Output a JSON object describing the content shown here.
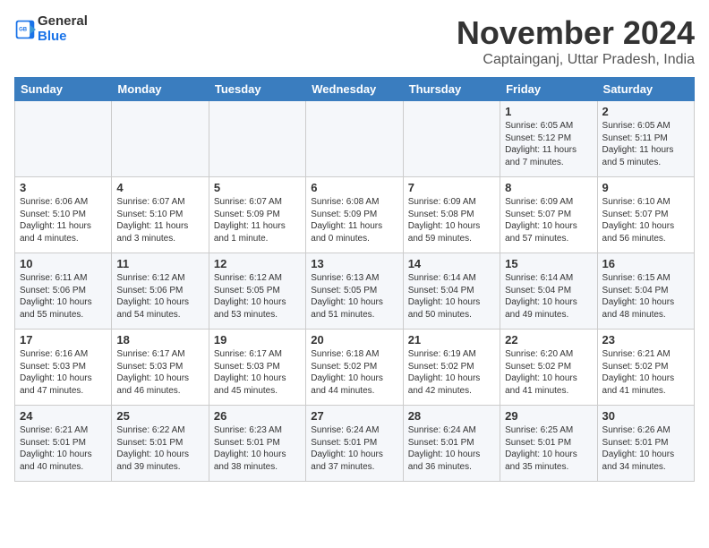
{
  "header": {
    "logo_general": "General",
    "logo_blue": "Blue",
    "month_title": "November 2024",
    "location": "Captainganj, Uttar Pradesh, India"
  },
  "weekdays": [
    "Sunday",
    "Monday",
    "Tuesday",
    "Wednesday",
    "Thursday",
    "Friday",
    "Saturday"
  ],
  "weeks": [
    [
      {
        "day": "",
        "info": ""
      },
      {
        "day": "",
        "info": ""
      },
      {
        "day": "",
        "info": ""
      },
      {
        "day": "",
        "info": ""
      },
      {
        "day": "",
        "info": ""
      },
      {
        "day": "1",
        "info": "Sunrise: 6:05 AM\nSunset: 5:12 PM\nDaylight: 11 hours and 7 minutes."
      },
      {
        "day": "2",
        "info": "Sunrise: 6:05 AM\nSunset: 5:11 PM\nDaylight: 11 hours and 5 minutes."
      }
    ],
    [
      {
        "day": "3",
        "info": "Sunrise: 6:06 AM\nSunset: 5:10 PM\nDaylight: 11 hours and 4 minutes."
      },
      {
        "day": "4",
        "info": "Sunrise: 6:07 AM\nSunset: 5:10 PM\nDaylight: 11 hours and 3 minutes."
      },
      {
        "day": "5",
        "info": "Sunrise: 6:07 AM\nSunset: 5:09 PM\nDaylight: 11 hours and 1 minute."
      },
      {
        "day": "6",
        "info": "Sunrise: 6:08 AM\nSunset: 5:09 PM\nDaylight: 11 hours and 0 minutes."
      },
      {
        "day": "7",
        "info": "Sunrise: 6:09 AM\nSunset: 5:08 PM\nDaylight: 10 hours and 59 minutes."
      },
      {
        "day": "8",
        "info": "Sunrise: 6:09 AM\nSunset: 5:07 PM\nDaylight: 10 hours and 57 minutes."
      },
      {
        "day": "9",
        "info": "Sunrise: 6:10 AM\nSunset: 5:07 PM\nDaylight: 10 hours and 56 minutes."
      }
    ],
    [
      {
        "day": "10",
        "info": "Sunrise: 6:11 AM\nSunset: 5:06 PM\nDaylight: 10 hours and 55 minutes."
      },
      {
        "day": "11",
        "info": "Sunrise: 6:12 AM\nSunset: 5:06 PM\nDaylight: 10 hours and 54 minutes."
      },
      {
        "day": "12",
        "info": "Sunrise: 6:12 AM\nSunset: 5:05 PM\nDaylight: 10 hours and 53 minutes."
      },
      {
        "day": "13",
        "info": "Sunrise: 6:13 AM\nSunset: 5:05 PM\nDaylight: 10 hours and 51 minutes."
      },
      {
        "day": "14",
        "info": "Sunrise: 6:14 AM\nSunset: 5:04 PM\nDaylight: 10 hours and 50 minutes."
      },
      {
        "day": "15",
        "info": "Sunrise: 6:14 AM\nSunset: 5:04 PM\nDaylight: 10 hours and 49 minutes."
      },
      {
        "day": "16",
        "info": "Sunrise: 6:15 AM\nSunset: 5:04 PM\nDaylight: 10 hours and 48 minutes."
      }
    ],
    [
      {
        "day": "17",
        "info": "Sunrise: 6:16 AM\nSunset: 5:03 PM\nDaylight: 10 hours and 47 minutes."
      },
      {
        "day": "18",
        "info": "Sunrise: 6:17 AM\nSunset: 5:03 PM\nDaylight: 10 hours and 46 minutes."
      },
      {
        "day": "19",
        "info": "Sunrise: 6:17 AM\nSunset: 5:03 PM\nDaylight: 10 hours and 45 minutes."
      },
      {
        "day": "20",
        "info": "Sunrise: 6:18 AM\nSunset: 5:02 PM\nDaylight: 10 hours and 44 minutes."
      },
      {
        "day": "21",
        "info": "Sunrise: 6:19 AM\nSunset: 5:02 PM\nDaylight: 10 hours and 42 minutes."
      },
      {
        "day": "22",
        "info": "Sunrise: 6:20 AM\nSunset: 5:02 PM\nDaylight: 10 hours and 41 minutes."
      },
      {
        "day": "23",
        "info": "Sunrise: 6:21 AM\nSunset: 5:02 PM\nDaylight: 10 hours and 41 minutes."
      }
    ],
    [
      {
        "day": "24",
        "info": "Sunrise: 6:21 AM\nSunset: 5:01 PM\nDaylight: 10 hours and 40 minutes."
      },
      {
        "day": "25",
        "info": "Sunrise: 6:22 AM\nSunset: 5:01 PM\nDaylight: 10 hours and 39 minutes."
      },
      {
        "day": "26",
        "info": "Sunrise: 6:23 AM\nSunset: 5:01 PM\nDaylight: 10 hours and 38 minutes."
      },
      {
        "day": "27",
        "info": "Sunrise: 6:24 AM\nSunset: 5:01 PM\nDaylight: 10 hours and 37 minutes."
      },
      {
        "day": "28",
        "info": "Sunrise: 6:24 AM\nSunset: 5:01 PM\nDaylight: 10 hours and 36 minutes."
      },
      {
        "day": "29",
        "info": "Sunrise: 6:25 AM\nSunset: 5:01 PM\nDaylight: 10 hours and 35 minutes."
      },
      {
        "day": "30",
        "info": "Sunrise: 6:26 AM\nSunset: 5:01 PM\nDaylight: 10 hours and 34 minutes."
      }
    ]
  ]
}
